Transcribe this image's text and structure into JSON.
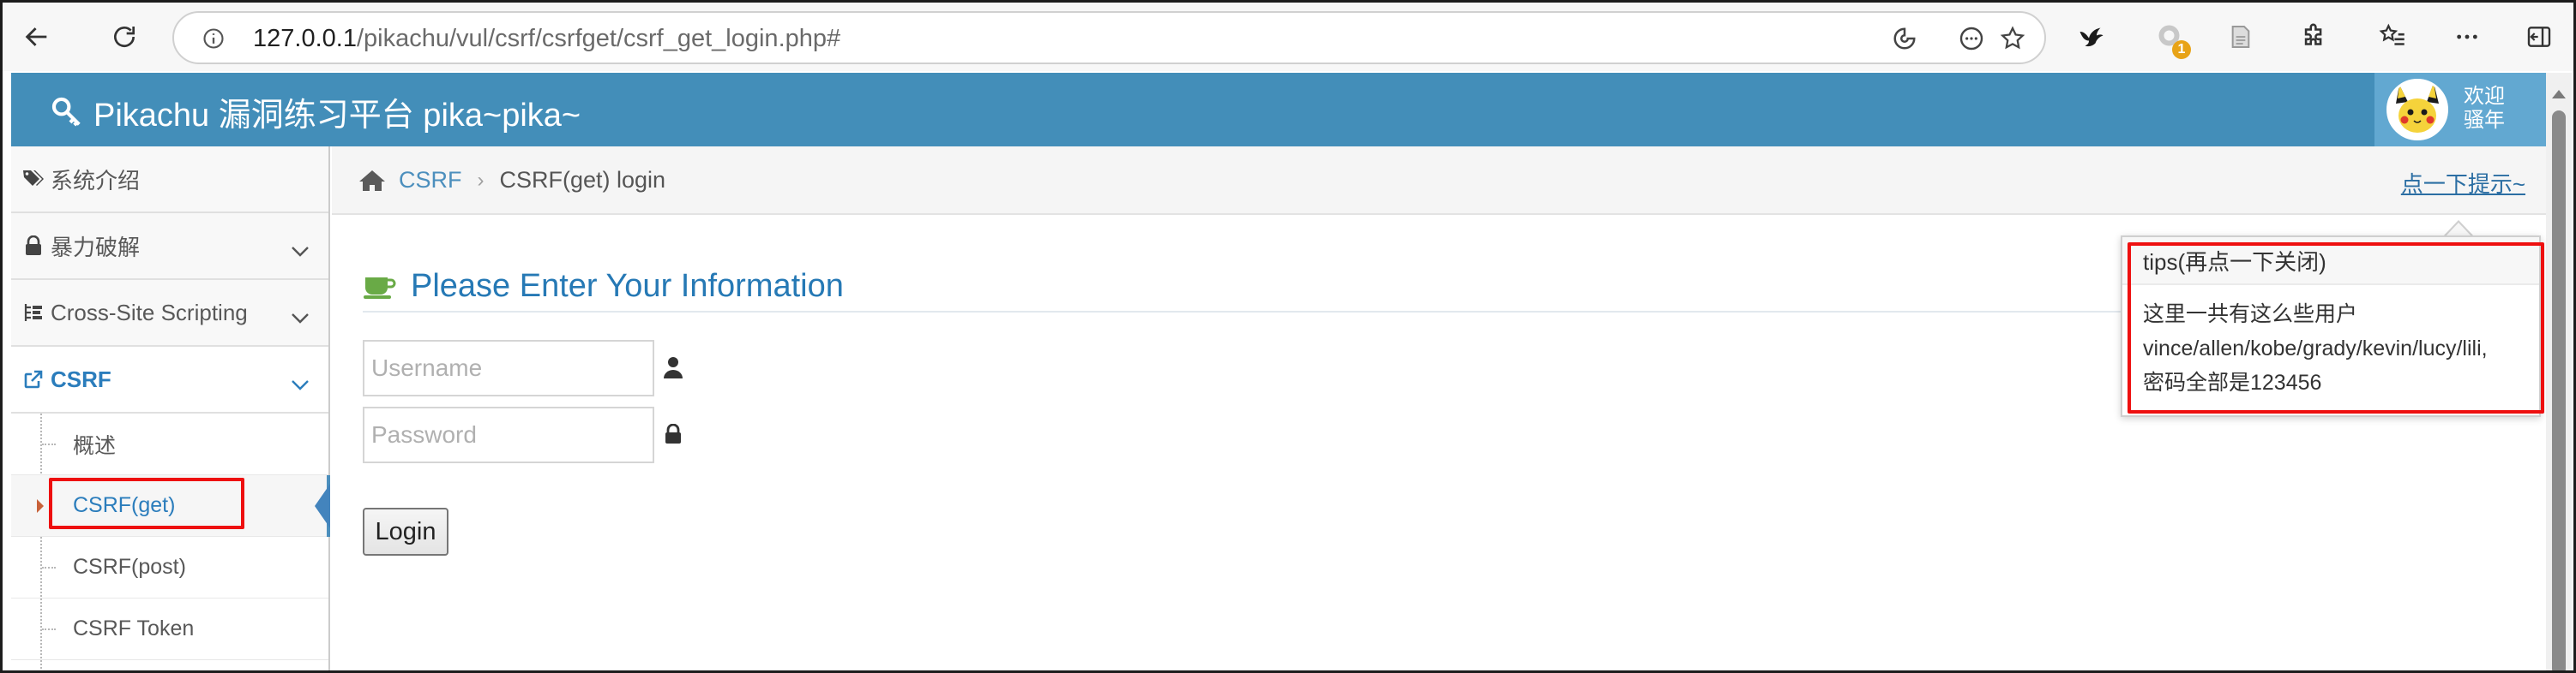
{
  "browser": {
    "url_host": "127.0.0.1",
    "url_path": "/pikachu/vul/csrf/csrfget/csrf_get_login.php#",
    "extension_badge": "1",
    "colors": {
      "toolbar_bg": "#f7f7f7",
      "badge": "#e8a317"
    }
  },
  "header": {
    "brand": "Pikachu 漏洞练习平台 pika~pika~",
    "welcome_line1": "欢迎",
    "welcome_line2": "骚年",
    "colors": {
      "bar": "#438eb9",
      "user_box": "#62a8d1"
    }
  },
  "sidebar": {
    "items": [
      {
        "label": "系统介绍",
        "icon": "tags-icon"
      },
      {
        "label": "暴力破解",
        "icon": "lock-icon"
      },
      {
        "label": "Cross-Site Scripting",
        "icon": "list-icon"
      },
      {
        "label": "CSRF",
        "icon": "share-icon"
      }
    ],
    "submenu": [
      {
        "label": "概述"
      },
      {
        "label": "CSRF(get)"
      },
      {
        "label": "CSRF(post)"
      },
      {
        "label": "CSRF Token"
      }
    ]
  },
  "breadcrumb": {
    "parent": "CSRF",
    "current": "CSRF(get) login",
    "tips_link": "点一下提示~"
  },
  "main": {
    "title": "Please Enter Your Information",
    "username_placeholder": "Username",
    "password_placeholder": "Password",
    "login_label": "Login"
  },
  "popover": {
    "title": "tips(再点一下关闭)",
    "line1": "这里一共有这么些用户",
    "line2": "vince/allen/kobe/grady/kevin/lucy/lili,",
    "line3": "密码全部是123456"
  },
  "highlight_color": "#ee0f0f"
}
